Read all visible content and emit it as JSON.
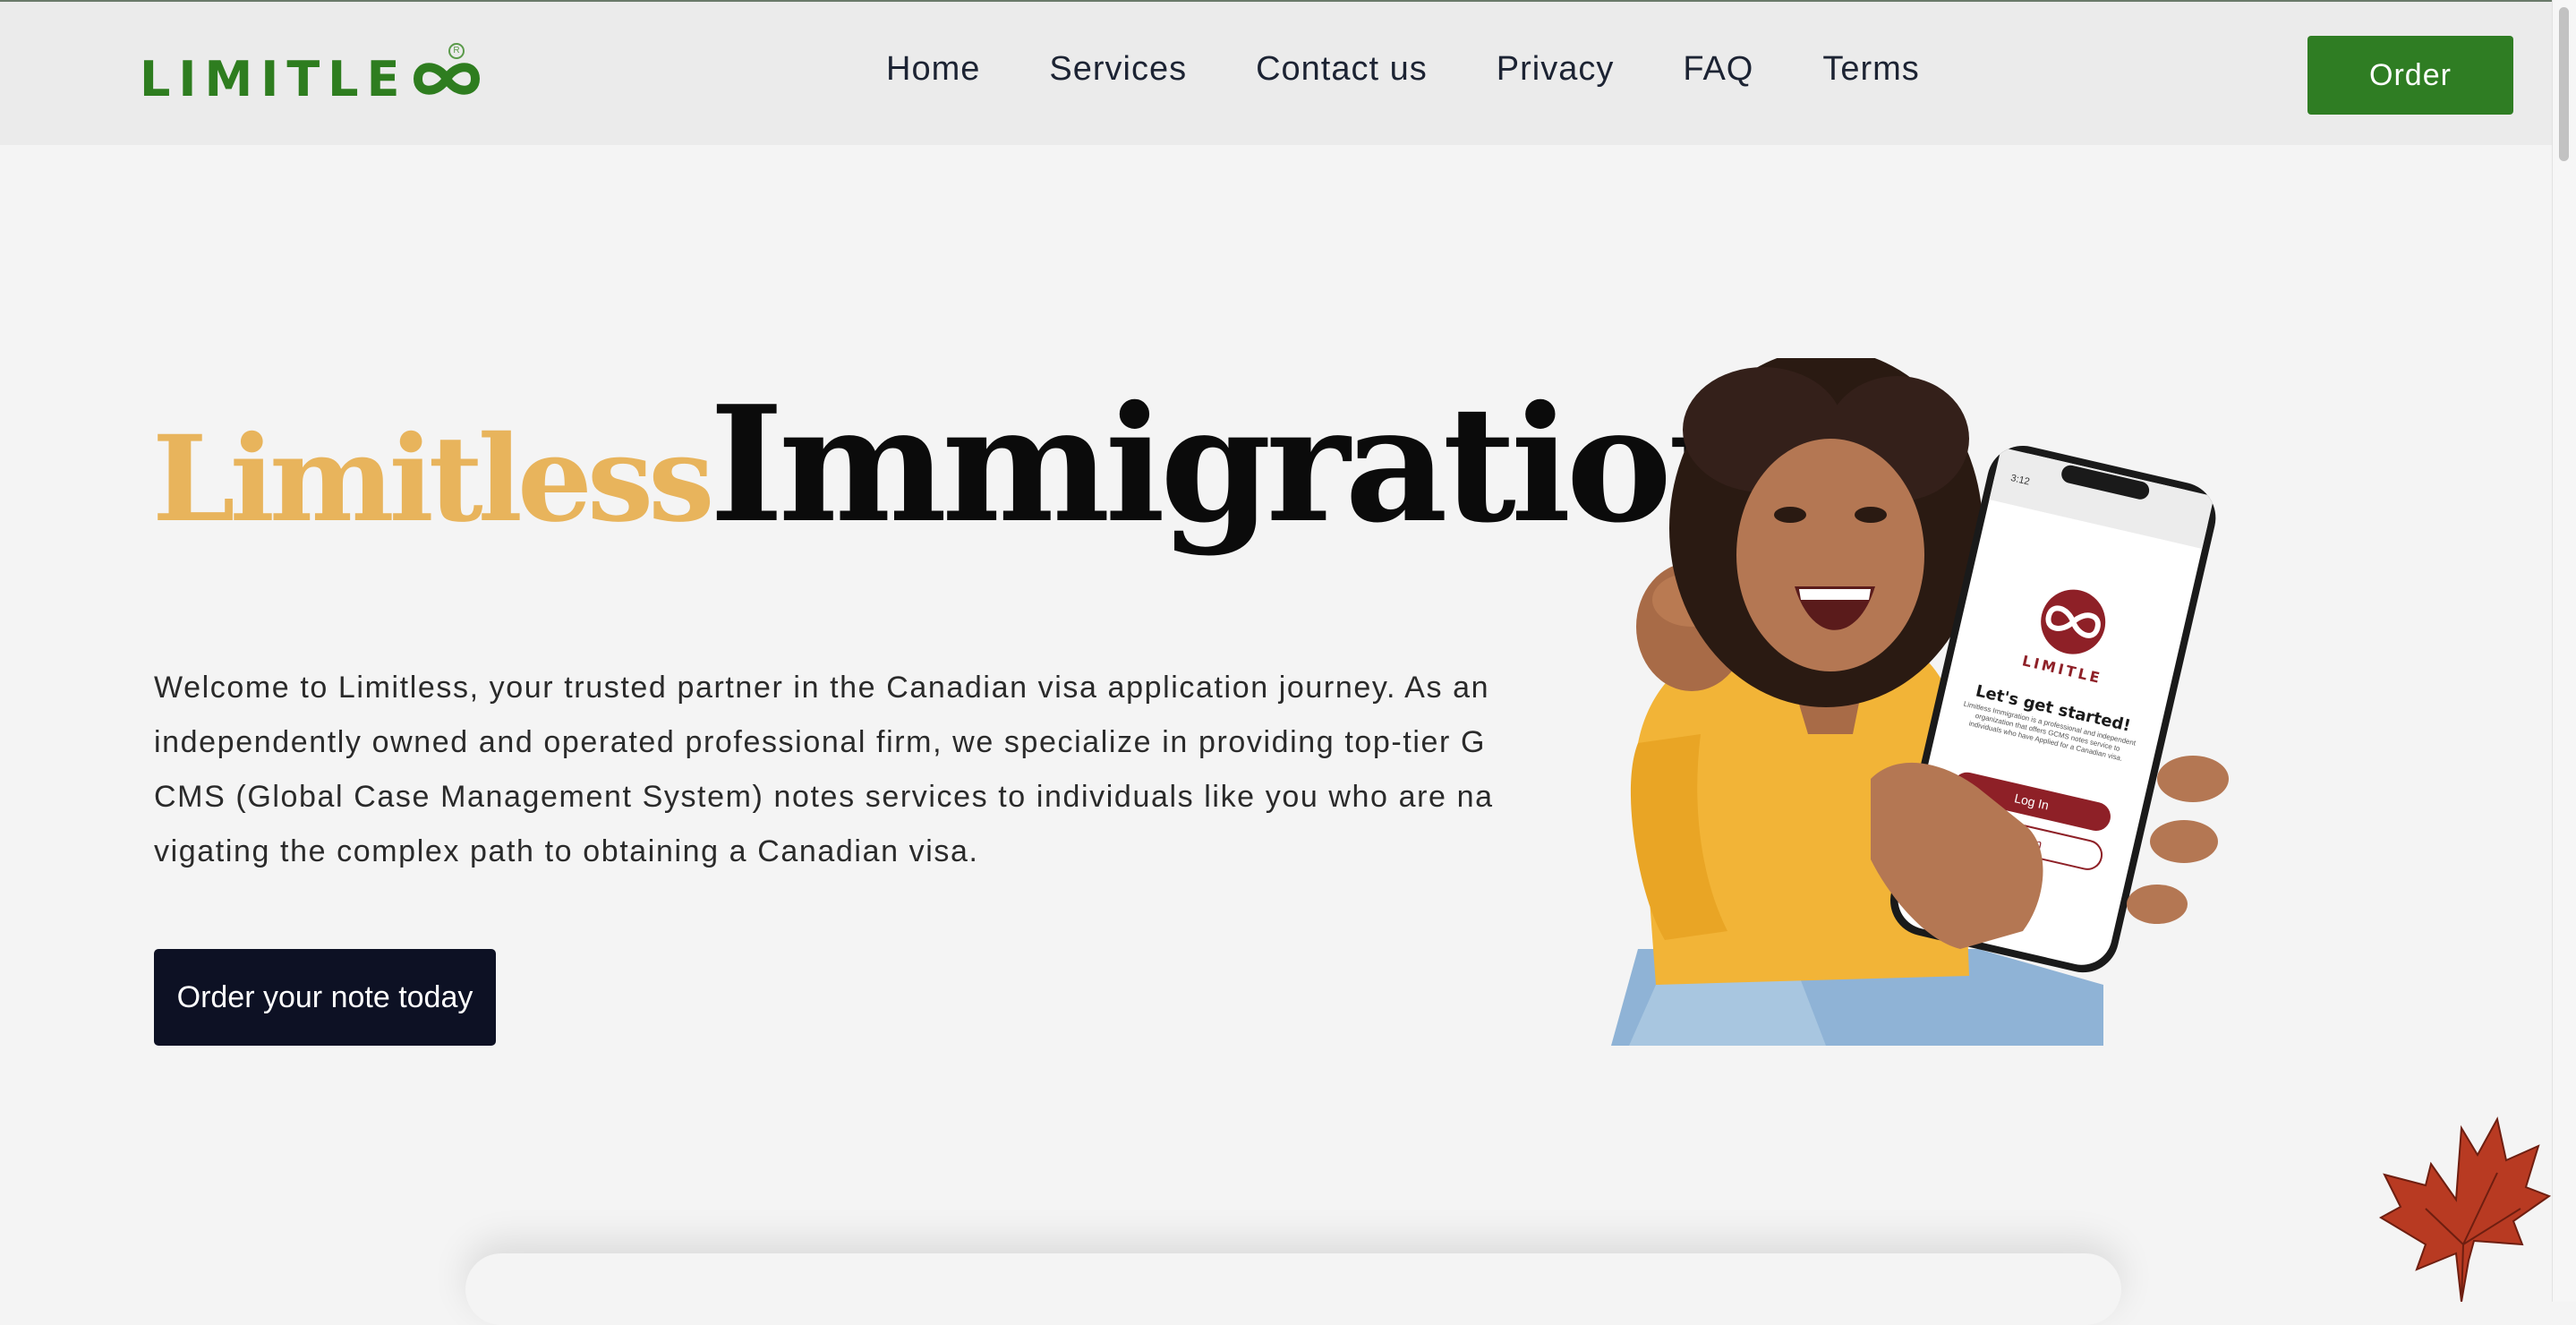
{
  "header": {
    "logo_text": "LIMITLE",
    "logo_icon": "infinity-icon",
    "nav": [
      {
        "label": "Home"
      },
      {
        "label": "Services"
      },
      {
        "label": "Contact us"
      },
      {
        "label": "Privacy"
      },
      {
        "label": "FAQ"
      },
      {
        "label": "Terms"
      }
    ],
    "order_label": "Order"
  },
  "hero": {
    "title_part1": "Limitless",
    "title_part2": "Immigration",
    "description": "Welcome to Limitless, your trusted partner in the Canadian visa application journey. As an independently owned and operated professional firm, we specialize in providing top-tier GCMS (Global Case Management System) notes services to individuals like you who are navigating the complex path to obtaining a Canadian visa.",
    "cta_label": "Order your note today",
    "phone": {
      "time": "3:12",
      "brand": "LIMITLE",
      "heading": "Let's get started!",
      "body": "Limitless Immigration is a professional and independent organization that offers GCMS notes service to individuals who have Applied for a Canadian visa.",
      "login_label": "Log In",
      "signin_label": "Sign In"
    }
  },
  "colors": {
    "brand_green": "#2f7d23",
    "title_gold": "#e8b45c",
    "cta_navy": "#0d1124",
    "app_red": "#8e2027"
  }
}
